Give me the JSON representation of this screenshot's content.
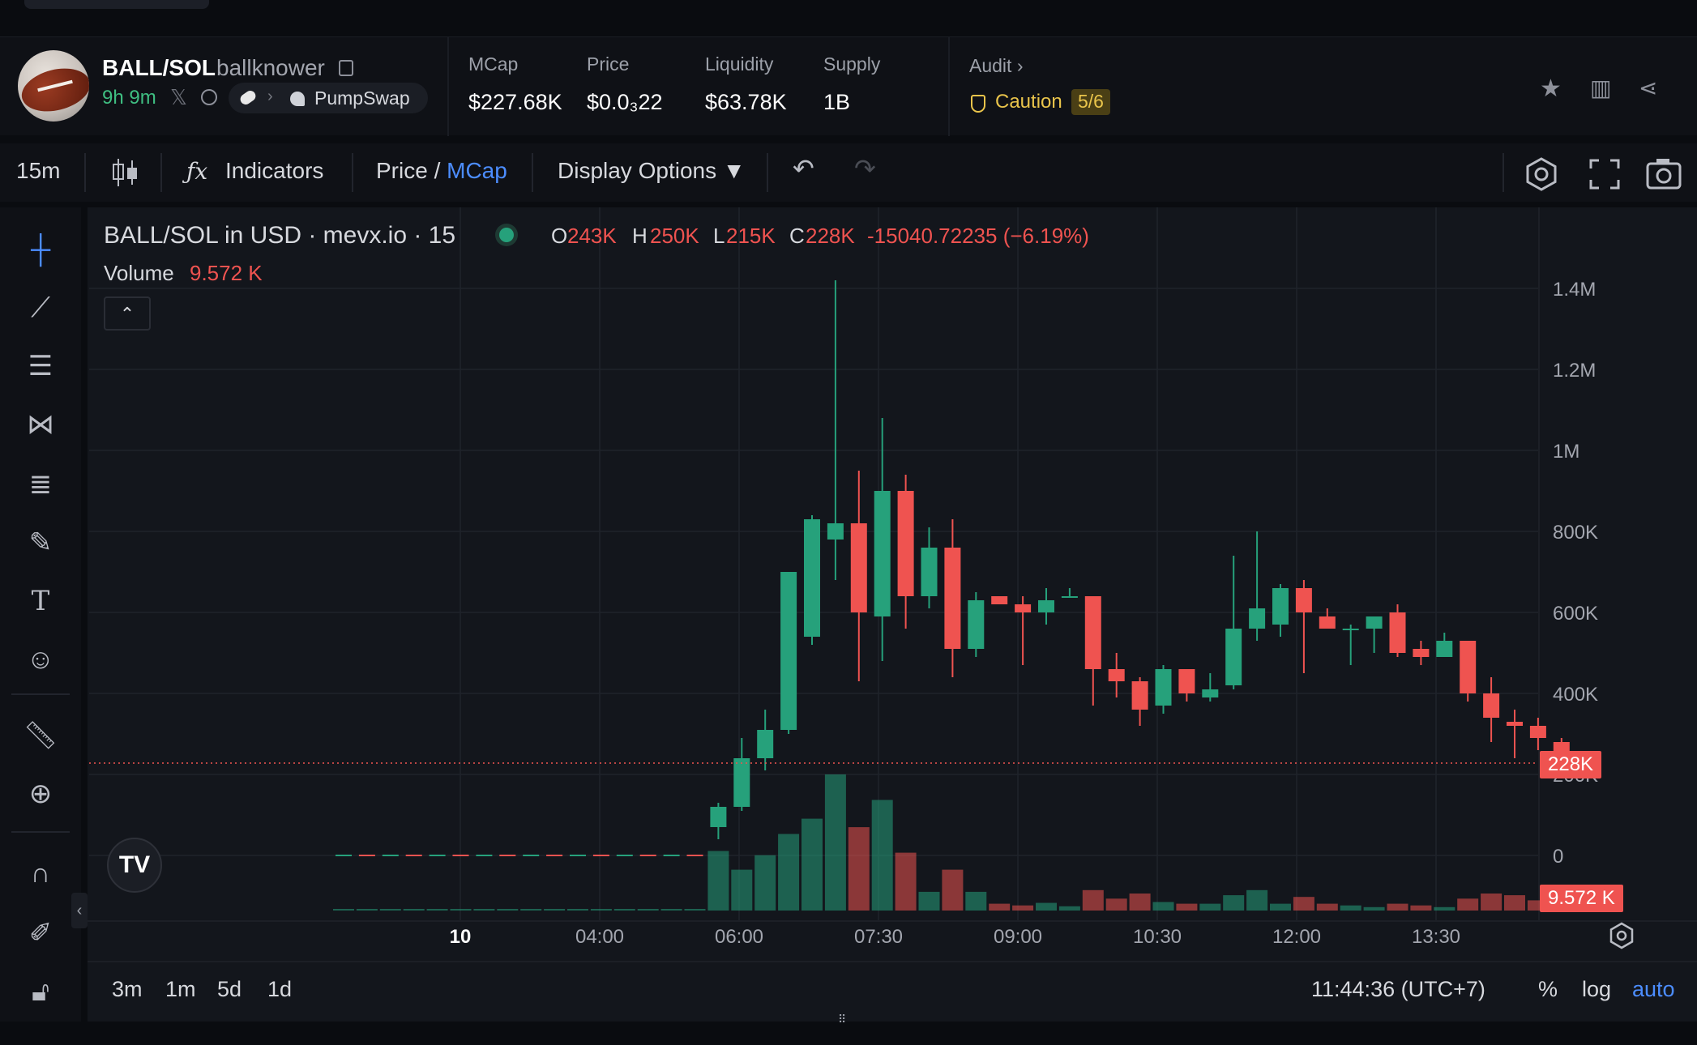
{
  "header": {
    "pair": "BALL/SOL",
    "username": "ballknower",
    "age": "9h 9m",
    "dex": "PumpSwap",
    "stats": [
      {
        "label": "MCap",
        "value": "$227.68K"
      },
      {
        "label": "Price",
        "value": "$0.0₃22"
      },
      {
        "label": "Liquidity",
        "value": "$63.78K"
      },
      {
        "label": "Supply",
        "value": "1B"
      }
    ],
    "audit_label": "Audit",
    "caution_label": "Caution",
    "caution_score": "5/6"
  },
  "toolbar": {
    "interval": "15m",
    "indicators": "Indicators",
    "price_label": "Price",
    "slash": " / ",
    "mcap_label": "MCap",
    "display_options": "Display Options ▼"
  },
  "legend": {
    "title": "BALL/SOL in USD · mevx.io · 15",
    "o_label": "O",
    "o_value": "243K",
    "h_label": "H",
    "h_value": "250K",
    "l_label": "L",
    "l_value": "215K",
    "c_label": "C",
    "c_value": "228K",
    "change": "-15040.72235 (−6.19%)",
    "volume_label": "Volume",
    "volume_value": "9.572 K"
  },
  "price_tag": "228K",
  "volume_tag": "9.572 K",
  "bottombar": {
    "ranges": [
      "3m",
      "1m",
      "5d",
      "1d"
    ],
    "time": "11:44:36 (UTC+7)",
    "percent": "%",
    "log": "log",
    "auto": "auto"
  },
  "colors": {
    "up": "#26a17b",
    "down": "#ef5350",
    "accent": "#4c8dff",
    "caution": "#e9c44b"
  },
  "chart_data": {
    "type": "candlestick",
    "price_axis_labels": [
      "1.4M",
      "1.2M",
      "1M",
      "800K",
      "600K",
      "400K",
      "200K",
      "0"
    ],
    "time_axis_labels": [
      "10",
      "04:00",
      "06:00",
      "07:30",
      "09:00",
      "10:30",
      "12:00",
      "13:30"
    ],
    "ylim": [
      0,
      1400000
    ],
    "current_price": 228000,
    "candles": [
      {
        "o": 0,
        "h": 0,
        "l": 0,
        "c": 0,
        "v": 0.2
      },
      {
        "o": 0,
        "h": 0,
        "l": 0,
        "c": 0,
        "v": 0.2
      },
      {
        "o": 0,
        "h": 0,
        "l": 0,
        "c": 0,
        "v": 0.2
      },
      {
        "o": 0,
        "h": 0,
        "l": 0,
        "c": 0,
        "v": 0.2
      },
      {
        "o": 0,
        "h": 0,
        "l": 0,
        "c": 0,
        "v": 0.2
      },
      {
        "o": 0,
        "h": 0,
        "l": 0,
        "c": 0,
        "v": 0.2
      },
      {
        "o": 0,
        "h": 0,
        "l": 0,
        "c": 0,
        "v": 0.2
      },
      {
        "o": 0,
        "h": 0,
        "l": 0,
        "c": 0,
        "v": 0.2
      },
      {
        "o": 0,
        "h": 0,
        "l": 0,
        "c": 0,
        "v": 0.2
      },
      {
        "o": 0,
        "h": 0,
        "l": 0,
        "c": 0,
        "v": 0.2
      },
      {
        "o": 0,
        "h": 0,
        "l": 0,
        "c": 0,
        "v": 0.2
      },
      {
        "o": 0,
        "h": 0,
        "l": 0,
        "c": 0,
        "v": 0.2
      },
      {
        "o": 0,
        "h": 0,
        "l": 0,
        "c": 0,
        "v": 0.2
      },
      {
        "o": 0,
        "h": 0,
        "l": 0,
        "c": 0,
        "v": 0.2
      },
      {
        "o": 0,
        "h": 0,
        "l": 0,
        "c": 0,
        "v": 0.2
      },
      {
        "o": 0,
        "h": 0,
        "l": 0,
        "c": 0,
        "v": 0.2
      },
      {
        "o": 70000,
        "h": 130000,
        "l": 40000,
        "c": 120000,
        "v": 70
      },
      {
        "o": 120000,
        "h": 290000,
        "l": 110000,
        "c": 240000,
        "v": 48
      },
      {
        "o": 240000,
        "h": 360000,
        "l": 210000,
        "c": 310000,
        "v": 65
      },
      {
        "o": 310000,
        "h": 680000,
        "l": 300000,
        "c": 700000,
        "v": 90
      },
      {
        "o": 540000,
        "h": 840000,
        "l": 520000,
        "c": 830000,
        "v": 108
      },
      {
        "o": 780000,
        "h": 1420000,
        "l": 680000,
        "c": 820000,
        "v": 160
      },
      {
        "o": 820000,
        "h": 950000,
        "l": 430000,
        "c": 600000,
        "v": 98
      },
      {
        "o": 590000,
        "h": 1080000,
        "l": 480000,
        "c": 900000,
        "v": 130
      },
      {
        "o": 900000,
        "h": 940000,
        "l": 560000,
        "c": 640000,
        "v": 68
      },
      {
        "o": 640000,
        "h": 810000,
        "l": 610000,
        "c": 760000,
        "v": 22
      },
      {
        "o": 760000,
        "h": 830000,
        "l": 440000,
        "c": 510000,
        "v": 48
      },
      {
        "o": 510000,
        "h": 650000,
        "l": 490000,
        "c": 630000,
        "v": 22
      },
      {
        "o": 640000,
        "h": 640000,
        "l": 620000,
        "c": 620000,
        "v": 8
      },
      {
        "o": 620000,
        "h": 640000,
        "l": 470000,
        "c": 600000,
        "v": 6
      },
      {
        "o": 600000,
        "h": 660000,
        "l": 570000,
        "c": 630000,
        "v": 9
      },
      {
        "o": 640000,
        "h": 660000,
        "l": 640000,
        "c": 640000,
        "v": 5
      },
      {
        "o": 640000,
        "h": 640000,
        "l": 370000,
        "c": 460000,
        "v": 24
      },
      {
        "o": 460000,
        "h": 500000,
        "l": 390000,
        "c": 430000,
        "v": 14
      },
      {
        "o": 430000,
        "h": 440000,
        "l": 320000,
        "c": 360000,
        "v": 20
      },
      {
        "o": 370000,
        "h": 470000,
        "l": 350000,
        "c": 460000,
        "v": 10
      },
      {
        "o": 460000,
        "h": 460000,
        "l": 380000,
        "c": 400000,
        "v": 8
      },
      {
        "o": 390000,
        "h": 450000,
        "l": 380000,
        "c": 410000,
        "v": 8
      },
      {
        "o": 420000,
        "h": 740000,
        "l": 410000,
        "c": 560000,
        "v": 18
      },
      {
        "o": 560000,
        "h": 800000,
        "l": 530000,
        "c": 610000,
        "v": 24
      },
      {
        "o": 570000,
        "h": 670000,
        "l": 540000,
        "c": 660000,
        "v": 8
      },
      {
        "o": 660000,
        "h": 680000,
        "l": 450000,
        "c": 600000,
        "v": 16
      },
      {
        "o": 590000,
        "h": 610000,
        "l": 560000,
        "c": 560000,
        "v": 8
      },
      {
        "o": 560000,
        "h": 570000,
        "l": 470000,
        "c": 560000,
        "v": 6
      },
      {
        "o": 560000,
        "h": 590000,
        "l": 500000,
        "c": 590000,
        "v": 4
      },
      {
        "o": 600000,
        "h": 620000,
        "l": 490000,
        "c": 500000,
        "v": 8
      },
      {
        "o": 510000,
        "h": 530000,
        "l": 470000,
        "c": 490000,
        "v": 6
      },
      {
        "o": 490000,
        "h": 550000,
        "l": 490000,
        "c": 530000,
        "v": 4
      },
      {
        "o": 530000,
        "h": 530000,
        "l": 380000,
        "c": 400000,
        "v": 14
      },
      {
        "o": 400000,
        "h": 440000,
        "l": 280000,
        "c": 340000,
        "v": 20
      },
      {
        "o": 330000,
        "h": 360000,
        "l": 240000,
        "c": 320000,
        "v": 18
      },
      {
        "o": 320000,
        "h": 340000,
        "l": 260000,
        "c": 290000,
        "v": 12
      },
      {
        "o": 280000,
        "h": 290000,
        "l": 210000,
        "c": 240000,
        "v": 10
      },
      {
        "o": 243000,
        "h": 250000,
        "l": 215000,
        "c": 228000,
        "v": 3
      }
    ]
  }
}
